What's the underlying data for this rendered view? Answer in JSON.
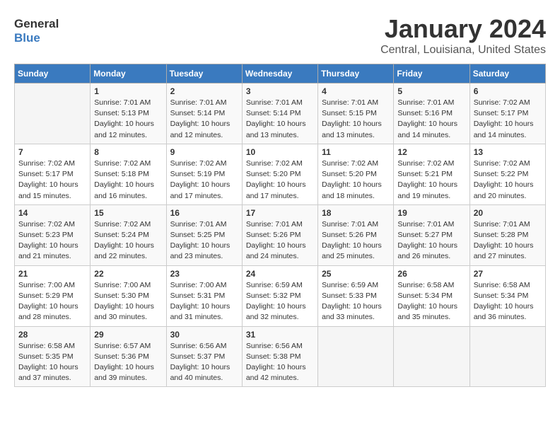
{
  "header": {
    "logo_general": "General",
    "logo_blue": "Blue",
    "title": "January 2024",
    "subtitle": "Central, Louisiana, United States"
  },
  "columns": [
    "Sunday",
    "Monday",
    "Tuesday",
    "Wednesday",
    "Thursday",
    "Friday",
    "Saturday"
  ],
  "weeks": [
    [
      {
        "day": "",
        "info": ""
      },
      {
        "day": "1",
        "info": "Sunrise: 7:01 AM\nSunset: 5:13 PM\nDaylight: 10 hours\nand 12 minutes."
      },
      {
        "day": "2",
        "info": "Sunrise: 7:01 AM\nSunset: 5:14 PM\nDaylight: 10 hours\nand 12 minutes."
      },
      {
        "day": "3",
        "info": "Sunrise: 7:01 AM\nSunset: 5:14 PM\nDaylight: 10 hours\nand 13 minutes."
      },
      {
        "day": "4",
        "info": "Sunrise: 7:01 AM\nSunset: 5:15 PM\nDaylight: 10 hours\nand 13 minutes."
      },
      {
        "day": "5",
        "info": "Sunrise: 7:01 AM\nSunset: 5:16 PM\nDaylight: 10 hours\nand 14 minutes."
      },
      {
        "day": "6",
        "info": "Sunrise: 7:02 AM\nSunset: 5:17 PM\nDaylight: 10 hours\nand 14 minutes."
      }
    ],
    [
      {
        "day": "7",
        "info": "Sunrise: 7:02 AM\nSunset: 5:17 PM\nDaylight: 10 hours\nand 15 minutes."
      },
      {
        "day": "8",
        "info": "Sunrise: 7:02 AM\nSunset: 5:18 PM\nDaylight: 10 hours\nand 16 minutes."
      },
      {
        "day": "9",
        "info": "Sunrise: 7:02 AM\nSunset: 5:19 PM\nDaylight: 10 hours\nand 17 minutes."
      },
      {
        "day": "10",
        "info": "Sunrise: 7:02 AM\nSunset: 5:20 PM\nDaylight: 10 hours\nand 17 minutes."
      },
      {
        "day": "11",
        "info": "Sunrise: 7:02 AM\nSunset: 5:20 PM\nDaylight: 10 hours\nand 18 minutes."
      },
      {
        "day": "12",
        "info": "Sunrise: 7:02 AM\nSunset: 5:21 PM\nDaylight: 10 hours\nand 19 minutes."
      },
      {
        "day": "13",
        "info": "Sunrise: 7:02 AM\nSunset: 5:22 PM\nDaylight: 10 hours\nand 20 minutes."
      }
    ],
    [
      {
        "day": "14",
        "info": "Sunrise: 7:02 AM\nSunset: 5:23 PM\nDaylight: 10 hours\nand 21 minutes."
      },
      {
        "day": "15",
        "info": "Sunrise: 7:02 AM\nSunset: 5:24 PM\nDaylight: 10 hours\nand 22 minutes."
      },
      {
        "day": "16",
        "info": "Sunrise: 7:01 AM\nSunset: 5:25 PM\nDaylight: 10 hours\nand 23 minutes."
      },
      {
        "day": "17",
        "info": "Sunrise: 7:01 AM\nSunset: 5:26 PM\nDaylight: 10 hours\nand 24 minutes."
      },
      {
        "day": "18",
        "info": "Sunrise: 7:01 AM\nSunset: 5:26 PM\nDaylight: 10 hours\nand 25 minutes."
      },
      {
        "day": "19",
        "info": "Sunrise: 7:01 AM\nSunset: 5:27 PM\nDaylight: 10 hours\nand 26 minutes."
      },
      {
        "day": "20",
        "info": "Sunrise: 7:01 AM\nSunset: 5:28 PM\nDaylight: 10 hours\nand 27 minutes."
      }
    ],
    [
      {
        "day": "21",
        "info": "Sunrise: 7:00 AM\nSunset: 5:29 PM\nDaylight: 10 hours\nand 28 minutes."
      },
      {
        "day": "22",
        "info": "Sunrise: 7:00 AM\nSunset: 5:30 PM\nDaylight: 10 hours\nand 30 minutes."
      },
      {
        "day": "23",
        "info": "Sunrise: 7:00 AM\nSunset: 5:31 PM\nDaylight: 10 hours\nand 31 minutes."
      },
      {
        "day": "24",
        "info": "Sunrise: 6:59 AM\nSunset: 5:32 PM\nDaylight: 10 hours\nand 32 minutes."
      },
      {
        "day": "25",
        "info": "Sunrise: 6:59 AM\nSunset: 5:33 PM\nDaylight: 10 hours\nand 33 minutes."
      },
      {
        "day": "26",
        "info": "Sunrise: 6:58 AM\nSunset: 5:34 PM\nDaylight: 10 hours\nand 35 minutes."
      },
      {
        "day": "27",
        "info": "Sunrise: 6:58 AM\nSunset: 5:34 PM\nDaylight: 10 hours\nand 36 minutes."
      }
    ],
    [
      {
        "day": "28",
        "info": "Sunrise: 6:58 AM\nSunset: 5:35 PM\nDaylight: 10 hours\nand 37 minutes."
      },
      {
        "day": "29",
        "info": "Sunrise: 6:57 AM\nSunset: 5:36 PM\nDaylight: 10 hours\nand 39 minutes."
      },
      {
        "day": "30",
        "info": "Sunrise: 6:56 AM\nSunset: 5:37 PM\nDaylight: 10 hours\nand 40 minutes."
      },
      {
        "day": "31",
        "info": "Sunrise: 6:56 AM\nSunset: 5:38 PM\nDaylight: 10 hours\nand 42 minutes."
      },
      {
        "day": "",
        "info": ""
      },
      {
        "day": "",
        "info": ""
      },
      {
        "day": "",
        "info": ""
      }
    ]
  ]
}
